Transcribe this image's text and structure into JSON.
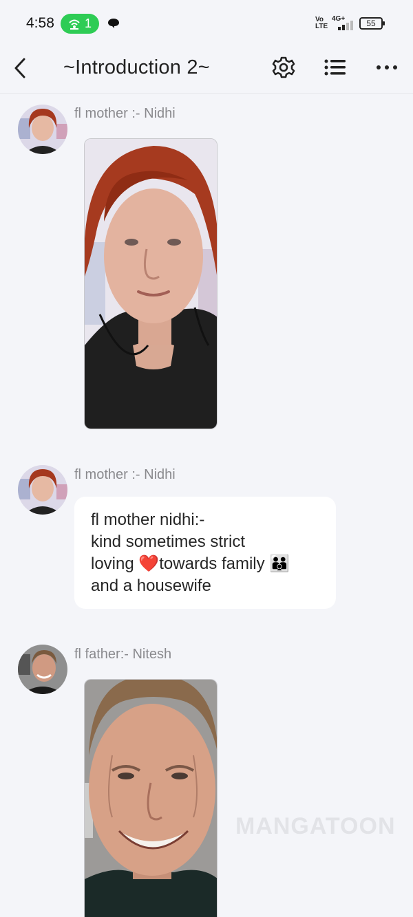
{
  "status_bar": {
    "time": "4:58",
    "hotspot_count": "1",
    "volte": "Vo\nLTE",
    "network": "4G+",
    "battery": "55"
  },
  "header": {
    "title": "~Introduction 2~",
    "icons": [
      "back-arrow-icon",
      "gear-icon",
      "list-icon",
      "more-icon"
    ]
  },
  "messages": [
    {
      "sender": "fl mother :- Nidhi",
      "type": "image",
      "subject": "mother"
    },
    {
      "sender": "fl mother :- Nidhi",
      "type": "text",
      "lines": [
        "fl mother nidhi:-",
        "kind sometimes strict",
        "loving ❤️towards family 👪",
        "and a housewife"
      ]
    },
    {
      "sender": "fl father:- Nitesh",
      "type": "image",
      "subject": "father"
    }
  ],
  "watermark": "MANGATOON",
  "colors": {
    "accent_green": "#2ecc55",
    "background": "#f4f5f9",
    "bubble": "#ffffff"
  }
}
